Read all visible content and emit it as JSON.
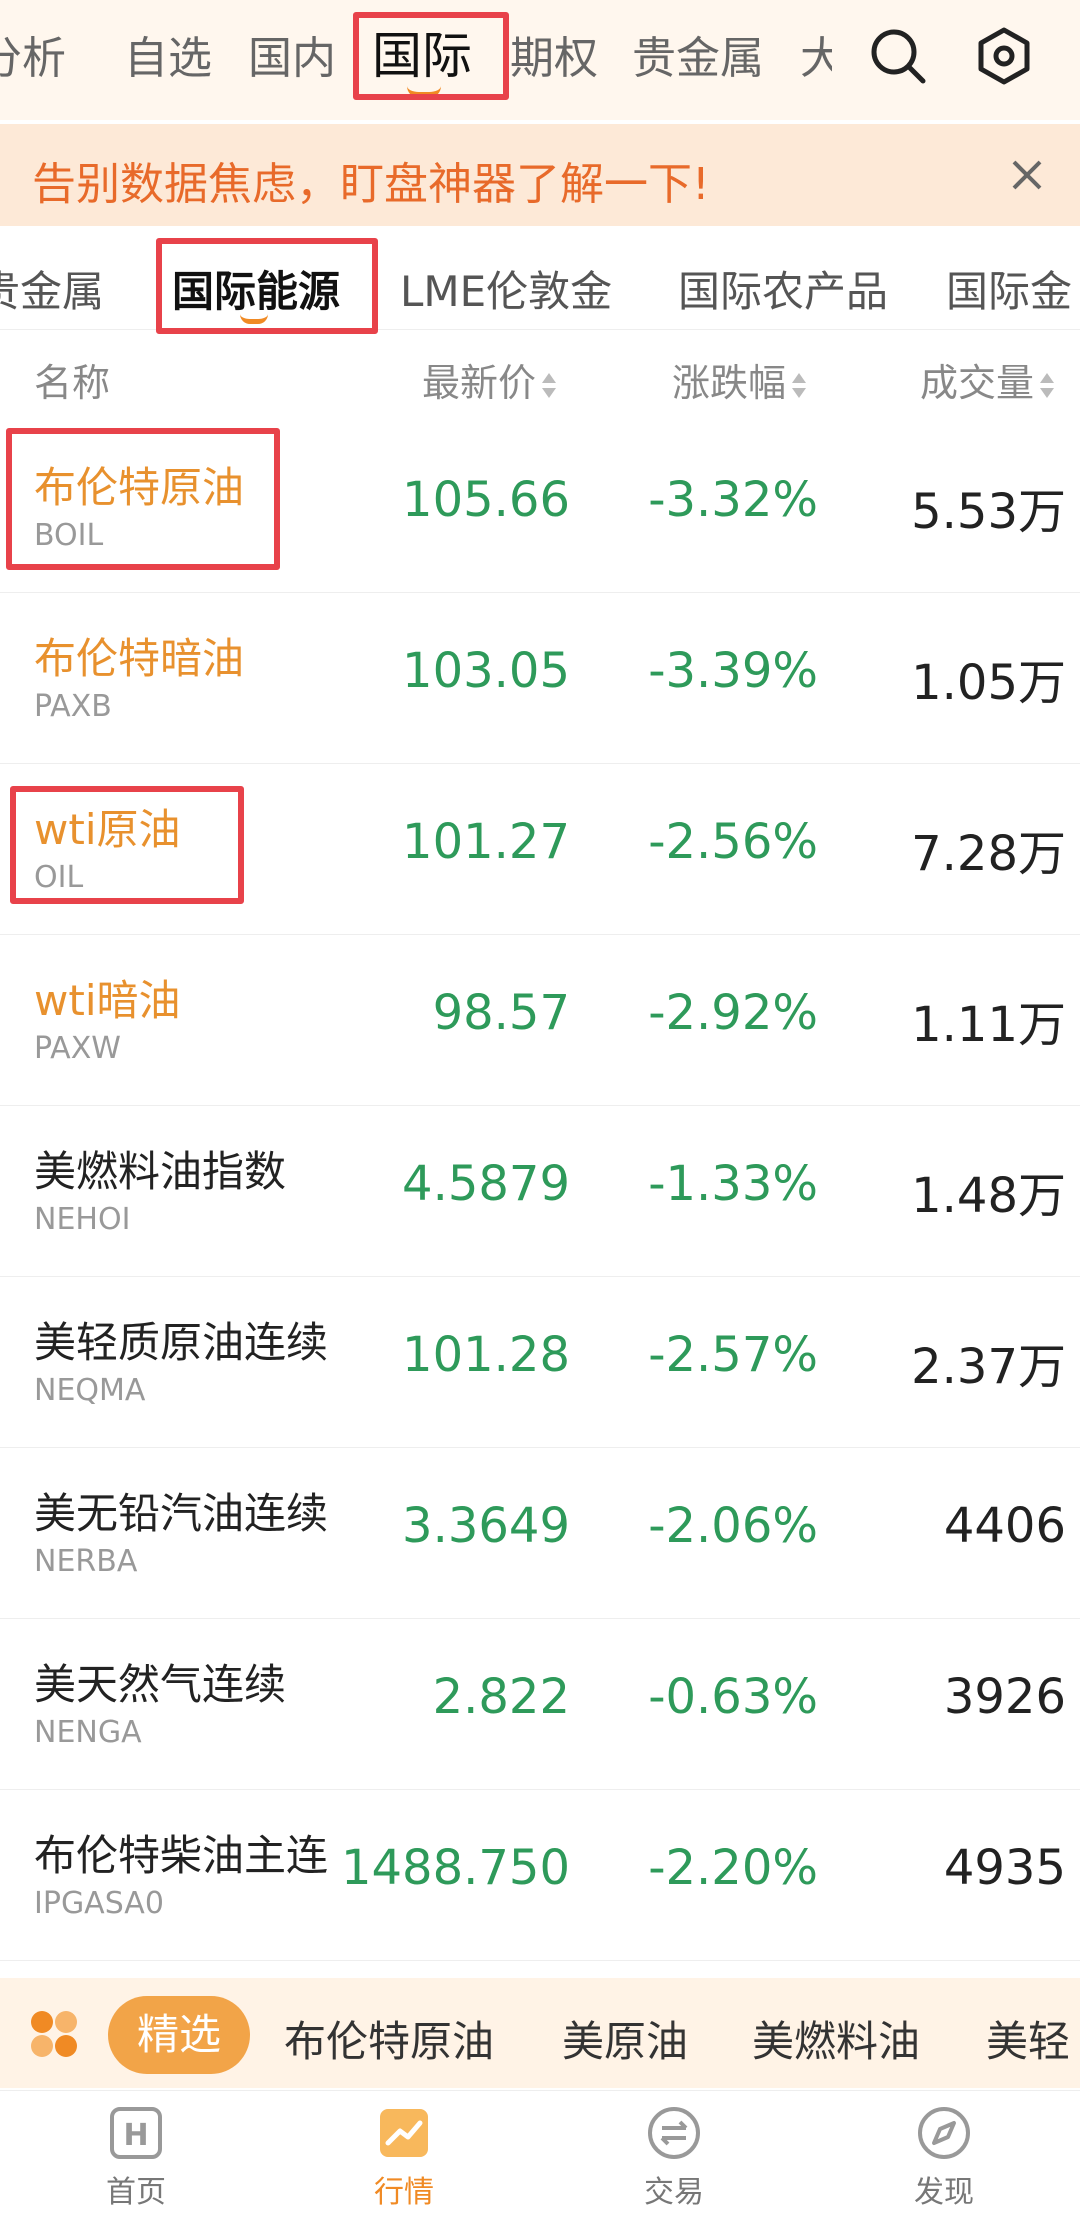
{
  "top_nav": {
    "tabs": [
      {
        "label": "分析"
      },
      {
        "label": "自选"
      },
      {
        "label": "国内"
      },
      {
        "label": "国际"
      },
      {
        "label": "期权"
      },
      {
        "label": "贵金属"
      },
      {
        "label": "大"
      }
    ],
    "active_tab": "国际",
    "icons": [
      "search-icon",
      "settings-hexagon-icon"
    ]
  },
  "banner": {
    "text": "告别数据焦虑，盯盘神器了解一下!",
    "close_icon": "close-icon"
  },
  "sub_nav": {
    "tabs": [
      {
        "label": "贵金属"
      },
      {
        "label": "国际能源"
      },
      {
        "label": "LME伦敦金"
      },
      {
        "label": "国际农产品"
      },
      {
        "label": "国际金"
      }
    ],
    "active_tab": "国际能源"
  },
  "table": {
    "headers": {
      "name": "名称",
      "price": "最新价",
      "change": "涨跌幅",
      "volume": "成交量"
    },
    "rows": [
      {
        "name": "布伦特原油",
        "code": "BOIL",
        "price": "105.66",
        "change": "-3.32%",
        "volume": "5.53万",
        "highlight_name": true
      },
      {
        "name": "布伦特暗油",
        "code": "PAXB",
        "price": "103.05",
        "change": "-3.39%",
        "volume": "1.05万",
        "highlight_name": true
      },
      {
        "name": "wti原油",
        "code": "OIL",
        "price": "101.27",
        "change": "-2.56%",
        "volume": "7.28万",
        "highlight_name": true
      },
      {
        "name": "wti暗油",
        "code": "PAXW",
        "price": "98.57",
        "change": "-2.92%",
        "volume": "1.11万",
        "highlight_name": true
      },
      {
        "name": "美燃料油指数",
        "code": "NEHOI",
        "price": "4.5879",
        "change": "-1.33%",
        "volume": "1.48万",
        "highlight_name": false
      },
      {
        "name": "美轻质原油连续",
        "code": "NEQMA",
        "price": "101.28",
        "change": "-2.57%",
        "volume": "2.37万",
        "highlight_name": false
      },
      {
        "name": "美无铅汽油连续",
        "code": "NERBA",
        "price": "3.3649",
        "change": "-2.06%",
        "volume": "4406",
        "highlight_name": false
      },
      {
        "name": "美天然气连续",
        "code": "NENGA",
        "price": "2.822",
        "change": "-0.63%",
        "volume": "3926",
        "highlight_name": false
      },
      {
        "name": "布伦特柴油主连",
        "code": "IPGASA0",
        "price": "1488.750",
        "change": "-2.20%",
        "volume": "4935",
        "highlight_name": false
      }
    ]
  },
  "quick_bar": {
    "grid_icon": "grid-icon",
    "active": "精选",
    "items": [
      "布伦特原油",
      "美原油",
      "美燃料油",
      "美轻"
    ]
  },
  "bottom_nav": {
    "items": [
      {
        "label": "首页",
        "icon": "home-icon"
      },
      {
        "label": "行情",
        "icon": "market-chart-icon"
      },
      {
        "label": "交易",
        "icon": "trade-icon"
      },
      {
        "label": "发现",
        "icon": "discover-compass-icon"
      }
    ],
    "active": "行情"
  },
  "colors": {
    "accent": "#f08a24",
    "down_green": "#2e9a5a",
    "highlight_name": "#e8912e",
    "annotation_box": "#e8424a"
  }
}
